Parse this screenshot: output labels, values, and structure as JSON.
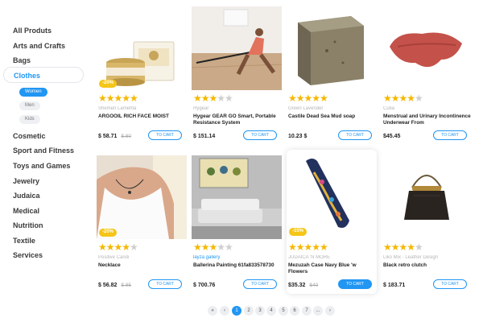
{
  "sidebar": {
    "categories": [
      "All Produts",
      "Arts and Crafts",
      "Bags",
      "Clothes",
      "Cosmetic",
      "Sport and Fitness",
      "Toys and Games",
      "Jewelry",
      "Judaica",
      "Medical",
      "Nutrition",
      "Textile",
      "Services"
    ],
    "active_category": "Clothes",
    "subcategories": [
      "Women",
      "Men",
      "Kids"
    ],
    "selected_subcategory": "Women"
  },
  "cart_label": "TO CART",
  "products": [
    {
      "brand": "Shemen Lamehta",
      "title": "ARGOOIL RICH FACE MOIST",
      "price": "$ 58.71",
      "old_price": "$ 80",
      "badge": "-20%",
      "rating": 4,
      "image": "face-cream-jar-image"
    },
    {
      "brand": "Hygear",
      "title": "Hygear GEAR GO Smart, Portable Resistance System",
      "price": "$ 151.14",
      "rating": 3,
      "image": "woman-exercising-image"
    },
    {
      "brand": "Green Lavender",
      "title": "Castile Dead Sea Mud soap",
      "price": "10.23 $",
      "rating": 5,
      "image": "mud-soap-bar-image"
    },
    {
      "brand": "Cutia",
      "title": "Menstrual and Urinary Incontinence Underwear From",
      "price": "$45.45",
      "rating": 4,
      "image": "underwear-image"
    },
    {
      "brand": "Positive Candi",
      "title": "Necklace",
      "price": "$ 56.82",
      "old_price": "$ 85",
      "badge": "-20%",
      "rating": 4,
      "image": "necklace-image"
    },
    {
      "brand": "layza gallery",
      "title": "Ballerina Painting 61fa833578730",
      "price": "$ 700.76",
      "rating": 3,
      "image": "ballerina-painting-image"
    },
    {
      "brand": "JUDAICA 'N MORE",
      "title": "Mezuzah Case Navy Blue 'w Flowers",
      "price": "$35.32",
      "old_price": "$40",
      "badge": "-15%",
      "rating": 5,
      "image": "mezuzah-case-image"
    },
    {
      "brand": "Liko Mix - Leather Design",
      "title": "Black retro clutch",
      "price": "$ 183.71",
      "rating": 4,
      "image": "black-clutch-image"
    }
  ],
  "pagination": {
    "prev_first": "«",
    "prev": "‹",
    "pages": [
      "1",
      "2",
      "3",
      "4",
      "5",
      "6",
      "7",
      "..."
    ],
    "current": "1",
    "next": "›"
  },
  "colors": {
    "accent": "#2196f3",
    "star": "#f5b800",
    "badge": "#f5c518"
  }
}
